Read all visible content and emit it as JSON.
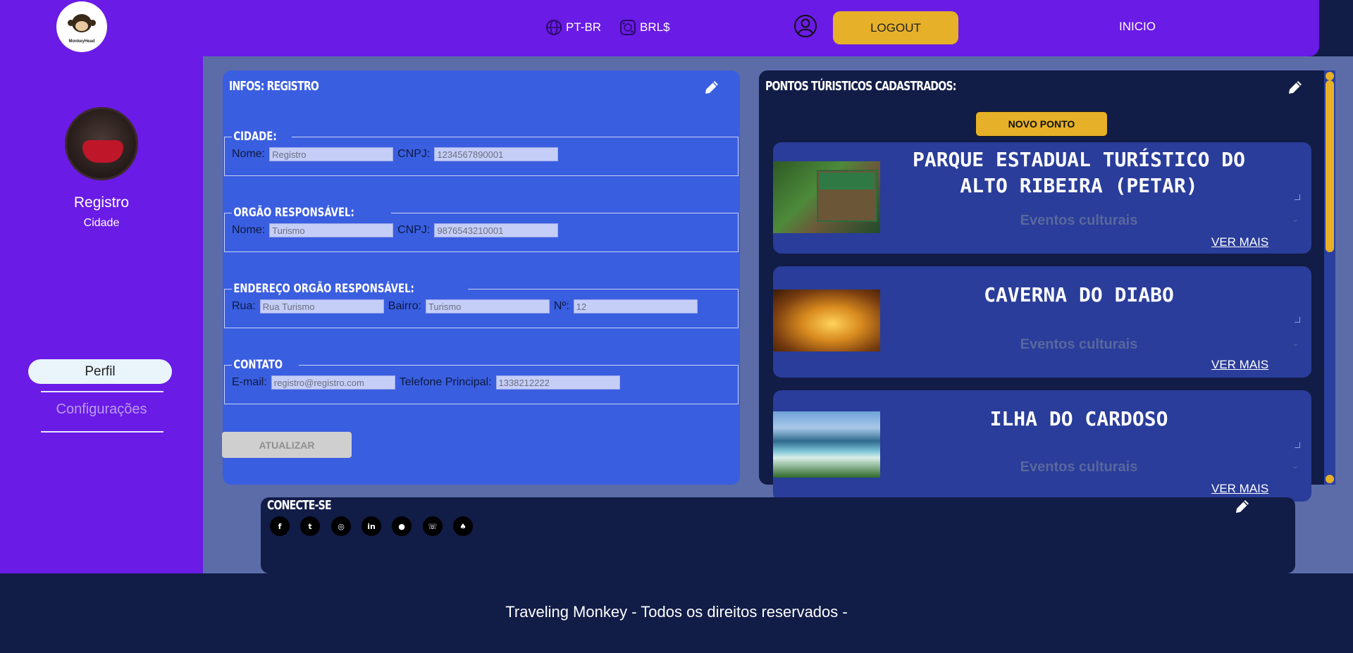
{
  "header": {
    "brand": "MonkeyHead",
    "language": "PT-BR",
    "currency": "BRL$",
    "logout_label": "LOGOUT",
    "inicio_label": "INICIO"
  },
  "sidebar": {
    "user_name": "Registro",
    "user_role": "Cidade",
    "items": [
      {
        "label": "Perfil",
        "active": true
      },
      {
        "label": "Configurações",
        "active": false
      }
    ]
  },
  "info": {
    "title": "INFOS: REGISTRO",
    "groups": {
      "cidade": {
        "legend": "CIDADE:",
        "nome_label": "Nome:",
        "nome_value": "Registro",
        "cnpj_label": "CNPJ:",
        "cnpj_value": "1234567890001"
      },
      "orgao": {
        "legend": "ORGÃO RESPONSÁVEL:",
        "nome_label": "Nome:",
        "nome_value": "Turismo",
        "cnpj_label": "CNPJ:",
        "cnpj_value": "9876543210001"
      },
      "endereco": {
        "legend": "ENDEREÇO ORGÃO RESPONSÁVEL:",
        "rua_label": "Rua:",
        "rua_value": "Rua Turismo",
        "bairro_label": "Bairro:",
        "bairro_value": "Turismo",
        "numero_label": "Nº:",
        "numero_value": "12"
      },
      "contato": {
        "legend": "CONTATO",
        "email_label": "E-mail:",
        "email_value": "registro@registro.com",
        "telefone_label": "Telefone Principal:",
        "telefone_value": "1338212222"
      }
    },
    "update_label": "ATUALIZAR"
  },
  "pontos": {
    "title": "PONTOS TÚRISTICOS CADASTRADOS:",
    "novo_label": "NOVO PONTO",
    "items": [
      {
        "name": "PARQUE ESTADUAL TURÍSTICO DO ALTO RIBEIRA (PETAR)",
        "category": "Eventos culturais",
        "more_label": "VER MAIS"
      },
      {
        "name": "CAVERNA DO DIABO",
        "category": "Eventos culturais",
        "more_label": "VER MAIS"
      },
      {
        "name": "ILHA DO CARDOSO",
        "category": "Eventos culturais",
        "more_label": "VER MAIS"
      }
    ]
  },
  "conecte": {
    "title": "CONECTE-SE",
    "socials": [
      "facebook-icon",
      "twitter-icon",
      "instagram-icon",
      "linkedin-icon",
      "github-icon",
      "whatsapp-icon",
      "snapchat-icon"
    ]
  },
  "footer": {
    "text": "Traveling Monkey - Todos os direitos reservados -"
  },
  "colors": {
    "primary_purple": "#6a1be6",
    "blue_card": "#3a5ee0",
    "navy": "#111c47",
    "gold": "#e6b028"
  }
}
